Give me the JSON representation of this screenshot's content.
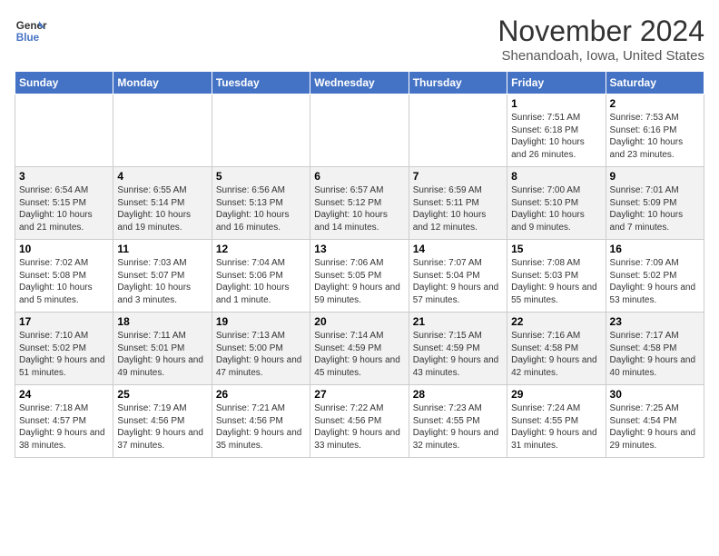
{
  "header": {
    "logo_line1": "General",
    "logo_line2": "Blue",
    "month": "November 2024",
    "location": "Shenandoah, Iowa, United States"
  },
  "weekdays": [
    "Sunday",
    "Monday",
    "Tuesday",
    "Wednesday",
    "Thursday",
    "Friday",
    "Saturday"
  ],
  "weeks": [
    [
      {
        "day": "",
        "info": ""
      },
      {
        "day": "",
        "info": ""
      },
      {
        "day": "",
        "info": ""
      },
      {
        "day": "",
        "info": ""
      },
      {
        "day": "",
        "info": ""
      },
      {
        "day": "1",
        "info": "Sunrise: 7:51 AM\nSunset: 6:18 PM\nDaylight: 10 hours and 26 minutes."
      },
      {
        "day": "2",
        "info": "Sunrise: 7:53 AM\nSunset: 6:16 PM\nDaylight: 10 hours and 23 minutes."
      }
    ],
    [
      {
        "day": "3",
        "info": "Sunrise: 6:54 AM\nSunset: 5:15 PM\nDaylight: 10 hours and 21 minutes."
      },
      {
        "day": "4",
        "info": "Sunrise: 6:55 AM\nSunset: 5:14 PM\nDaylight: 10 hours and 19 minutes."
      },
      {
        "day": "5",
        "info": "Sunrise: 6:56 AM\nSunset: 5:13 PM\nDaylight: 10 hours and 16 minutes."
      },
      {
        "day": "6",
        "info": "Sunrise: 6:57 AM\nSunset: 5:12 PM\nDaylight: 10 hours and 14 minutes."
      },
      {
        "day": "7",
        "info": "Sunrise: 6:59 AM\nSunset: 5:11 PM\nDaylight: 10 hours and 12 minutes."
      },
      {
        "day": "8",
        "info": "Sunrise: 7:00 AM\nSunset: 5:10 PM\nDaylight: 10 hours and 9 minutes."
      },
      {
        "day": "9",
        "info": "Sunrise: 7:01 AM\nSunset: 5:09 PM\nDaylight: 10 hours and 7 minutes."
      }
    ],
    [
      {
        "day": "10",
        "info": "Sunrise: 7:02 AM\nSunset: 5:08 PM\nDaylight: 10 hours and 5 minutes."
      },
      {
        "day": "11",
        "info": "Sunrise: 7:03 AM\nSunset: 5:07 PM\nDaylight: 10 hours and 3 minutes."
      },
      {
        "day": "12",
        "info": "Sunrise: 7:04 AM\nSunset: 5:06 PM\nDaylight: 10 hours and 1 minute."
      },
      {
        "day": "13",
        "info": "Sunrise: 7:06 AM\nSunset: 5:05 PM\nDaylight: 9 hours and 59 minutes."
      },
      {
        "day": "14",
        "info": "Sunrise: 7:07 AM\nSunset: 5:04 PM\nDaylight: 9 hours and 57 minutes."
      },
      {
        "day": "15",
        "info": "Sunrise: 7:08 AM\nSunset: 5:03 PM\nDaylight: 9 hours and 55 minutes."
      },
      {
        "day": "16",
        "info": "Sunrise: 7:09 AM\nSunset: 5:02 PM\nDaylight: 9 hours and 53 minutes."
      }
    ],
    [
      {
        "day": "17",
        "info": "Sunrise: 7:10 AM\nSunset: 5:02 PM\nDaylight: 9 hours and 51 minutes."
      },
      {
        "day": "18",
        "info": "Sunrise: 7:11 AM\nSunset: 5:01 PM\nDaylight: 9 hours and 49 minutes."
      },
      {
        "day": "19",
        "info": "Sunrise: 7:13 AM\nSunset: 5:00 PM\nDaylight: 9 hours and 47 minutes."
      },
      {
        "day": "20",
        "info": "Sunrise: 7:14 AM\nSunset: 4:59 PM\nDaylight: 9 hours and 45 minutes."
      },
      {
        "day": "21",
        "info": "Sunrise: 7:15 AM\nSunset: 4:59 PM\nDaylight: 9 hours and 43 minutes."
      },
      {
        "day": "22",
        "info": "Sunrise: 7:16 AM\nSunset: 4:58 PM\nDaylight: 9 hours and 42 minutes."
      },
      {
        "day": "23",
        "info": "Sunrise: 7:17 AM\nSunset: 4:58 PM\nDaylight: 9 hours and 40 minutes."
      }
    ],
    [
      {
        "day": "24",
        "info": "Sunrise: 7:18 AM\nSunset: 4:57 PM\nDaylight: 9 hours and 38 minutes."
      },
      {
        "day": "25",
        "info": "Sunrise: 7:19 AM\nSunset: 4:56 PM\nDaylight: 9 hours and 37 minutes."
      },
      {
        "day": "26",
        "info": "Sunrise: 7:21 AM\nSunset: 4:56 PM\nDaylight: 9 hours and 35 minutes."
      },
      {
        "day": "27",
        "info": "Sunrise: 7:22 AM\nSunset: 4:56 PM\nDaylight: 9 hours and 33 minutes."
      },
      {
        "day": "28",
        "info": "Sunrise: 7:23 AM\nSunset: 4:55 PM\nDaylight: 9 hours and 32 minutes."
      },
      {
        "day": "29",
        "info": "Sunrise: 7:24 AM\nSunset: 4:55 PM\nDaylight: 9 hours and 31 minutes."
      },
      {
        "day": "30",
        "info": "Sunrise: 7:25 AM\nSunset: 4:54 PM\nDaylight: 9 hours and 29 minutes."
      }
    ]
  ]
}
